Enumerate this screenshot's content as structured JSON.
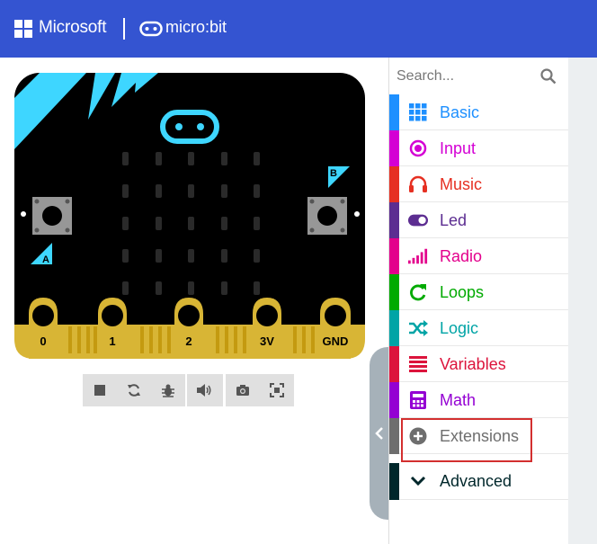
{
  "header": {
    "brand": "Microsoft",
    "product": "micro:bit"
  },
  "simulator": {
    "pins": [
      "0",
      "1",
      "2",
      "3V",
      "GND"
    ],
    "buttons": [
      "A",
      "B"
    ],
    "toolbar_icons": [
      "stop-icon",
      "restart-icon",
      "debug-icon",
      "sound-icon",
      "screenshot-icon",
      "fullscreen-icon"
    ]
  },
  "toolbox": {
    "search_placeholder": "Search...",
    "categories": [
      {
        "label": "Basic",
        "color": "#1e90ff",
        "icon": "grid-icon"
      },
      {
        "label": "Input",
        "color": "#d400d4",
        "icon": "radio-button-icon"
      },
      {
        "label": "Music",
        "color": "#e63022",
        "icon": "headphones-icon"
      },
      {
        "label": "Led",
        "color": "#5c2d91",
        "icon": "toggle-icon"
      },
      {
        "label": "Radio",
        "color": "#e3008c",
        "icon": "signal-bars-icon"
      },
      {
        "label": "Loops",
        "color": "#00aa00",
        "icon": "refresh-icon"
      },
      {
        "label": "Logic",
        "color": "#00a4a6",
        "icon": "shuffle-icon"
      },
      {
        "label": "Variables",
        "color": "#dc143c",
        "icon": "list-icon"
      },
      {
        "label": "Math",
        "color": "#9400d3",
        "icon": "calculator-icon"
      },
      {
        "label": "Extensions",
        "color": "#6e6e6e",
        "icon": "plus-circle-icon"
      },
      {
        "label": "Advanced",
        "color": "#00272b",
        "icon": "chevron-down-icon"
      }
    ]
  }
}
